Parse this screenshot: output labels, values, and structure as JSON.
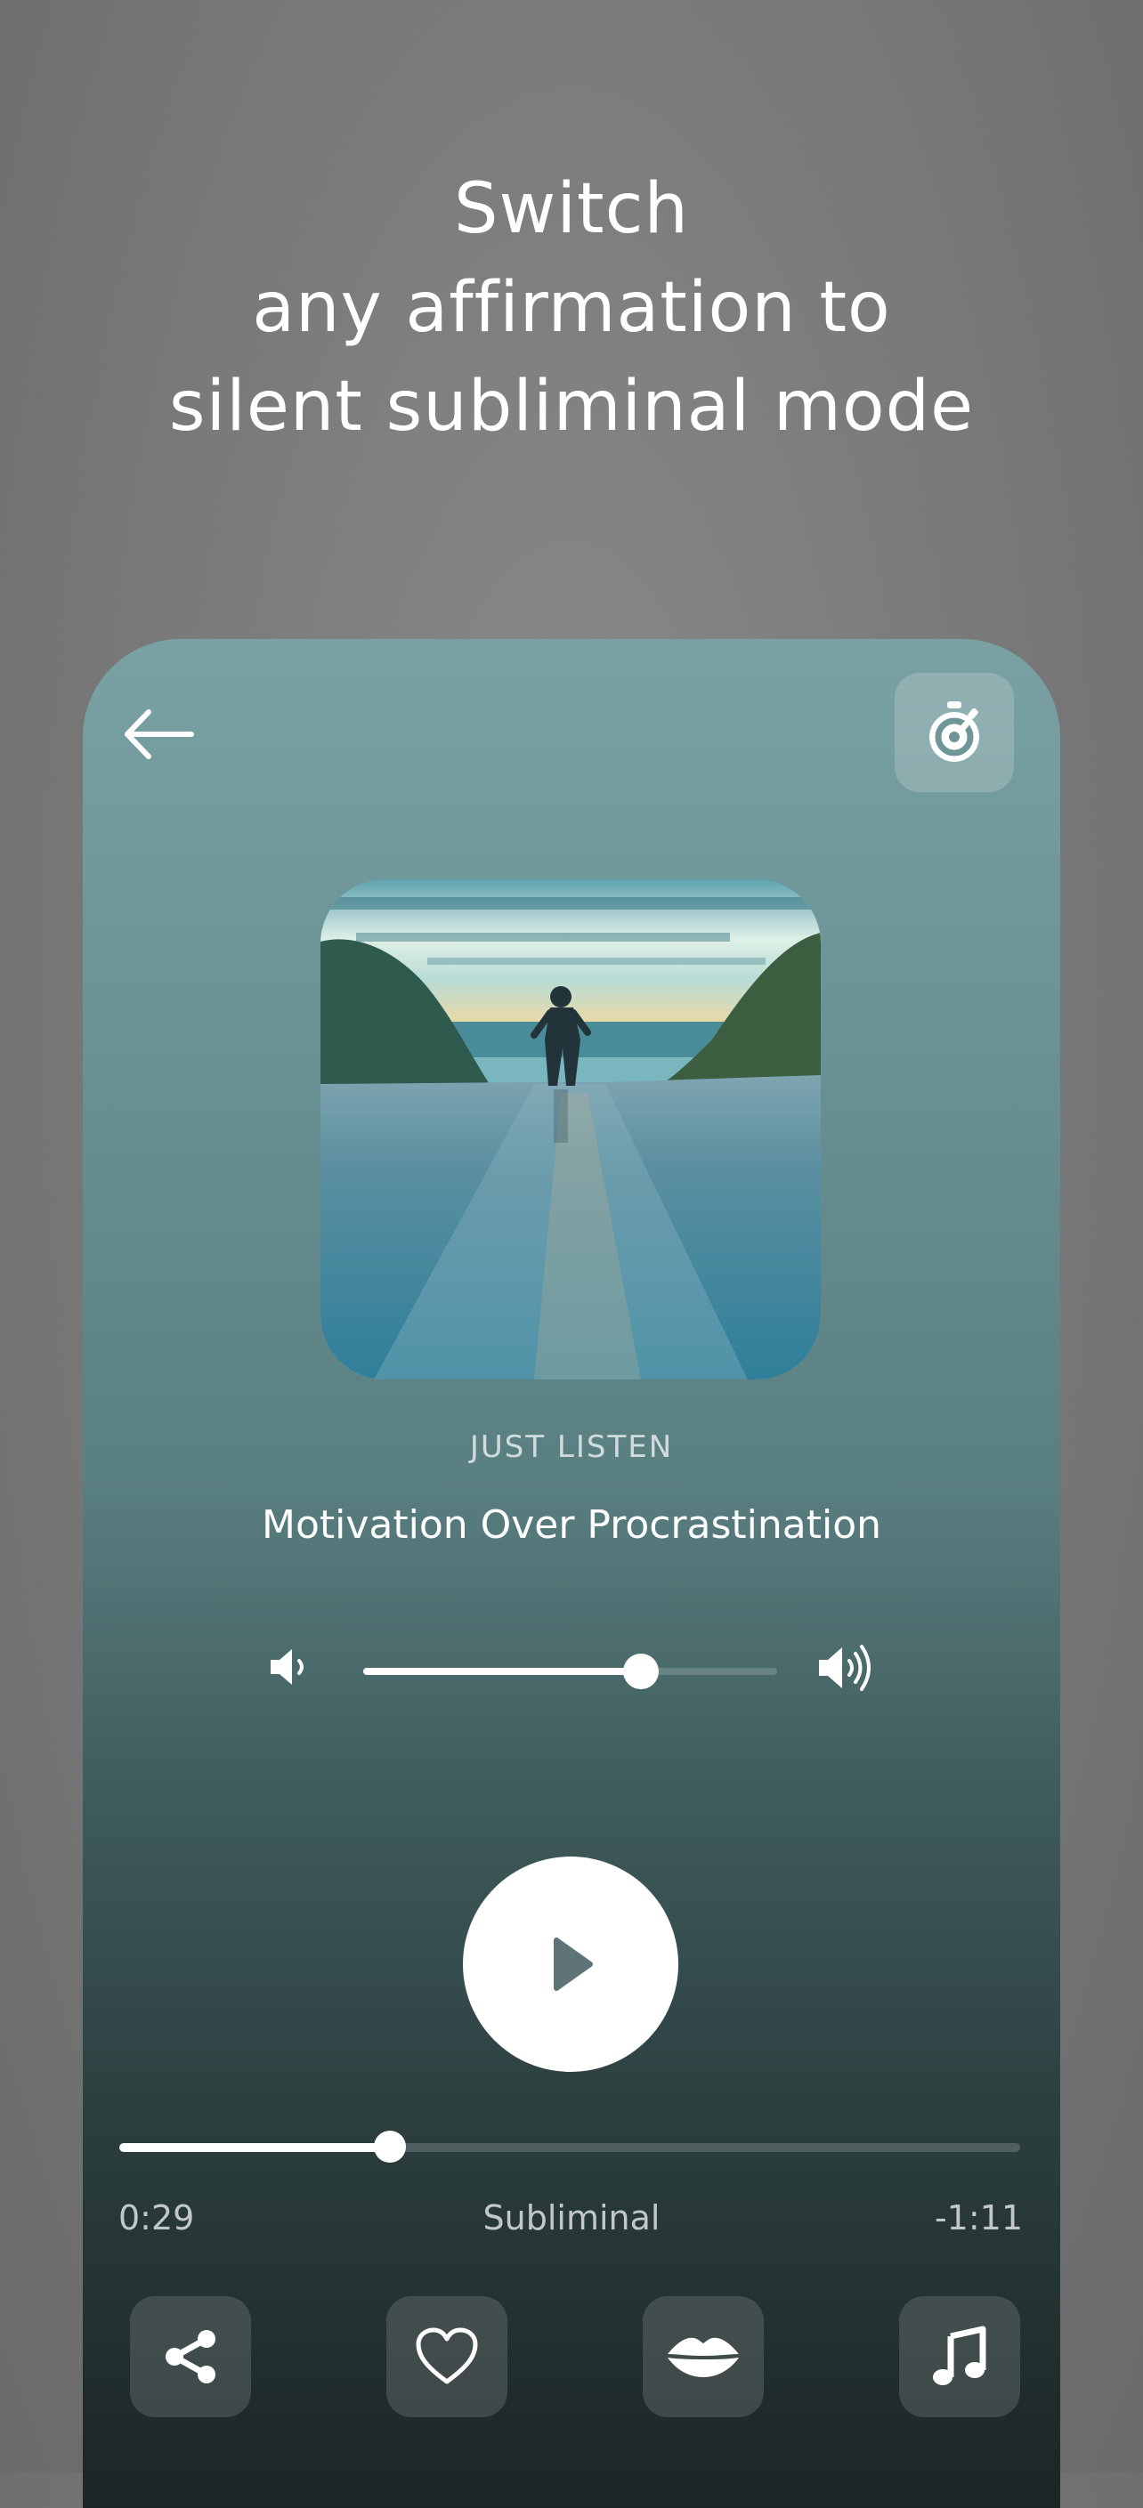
{
  "headline": {
    "line1": "Switch",
    "line2": "any affirmation to",
    "line3": "silent subliminal mode"
  },
  "player": {
    "back_icon": "arrow-left-icon",
    "timer_icon": "stopwatch-icon",
    "cover_image": "runner-on-wet-road-at-dusk",
    "category": "JUST LISTEN",
    "title": "Motivation Over Procrastination",
    "volume": {
      "level": 0.67,
      "low_icon": "volume-low-icon",
      "high_icon": "volume-high-icon"
    },
    "play_icon": "play-icon",
    "progress": {
      "fraction": 0.3
    },
    "elapsed": "0:29",
    "mode": "Subliminal",
    "remaining": "-1:11",
    "actions": [
      {
        "name": "share",
        "icon": "share-icon"
      },
      {
        "name": "favorite",
        "icon": "heart-icon"
      },
      {
        "name": "voice",
        "icon": "lips-icon"
      },
      {
        "name": "music",
        "icon": "music-note-icon"
      }
    ]
  },
  "colors": {
    "background": "#7c7c7c",
    "panel_top": "#7aa1a3",
    "panel_bottom": "#1b2525",
    "accent": "#ffffff",
    "play_icon": "#5f7476"
  }
}
